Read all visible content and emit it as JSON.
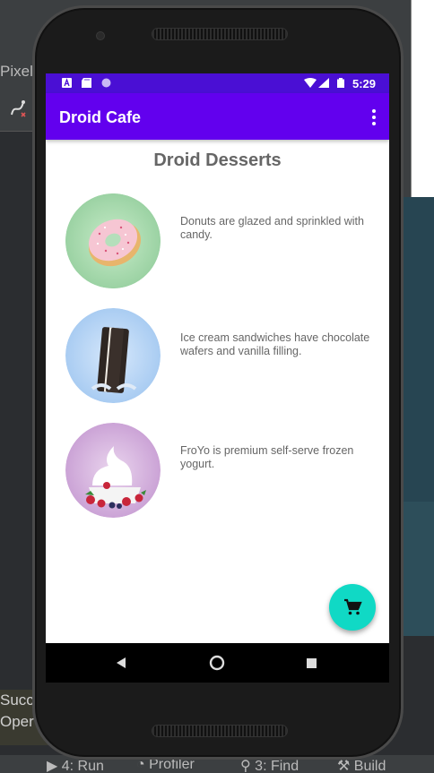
{
  "app": {
    "title": "Droid Cafe",
    "heading": "Droid Desserts",
    "time": "5:29"
  },
  "desserts": [
    {
      "name": "donut",
      "description": "Donuts are glazed and sprinkled with candy."
    },
    {
      "name": "ice-cream-sandwich",
      "description": "Ice cream sandwiches have chocolate wafers and vanilla filling."
    },
    {
      "name": "froyo",
      "description": "FroYo is premium self-serve frozen yogurt."
    }
  ],
  "ide": {
    "device_label": "Pixel",
    "console_lines": [
      "Succ",
      "Oper"
    ],
    "bottom_tabs": [
      "4: Run",
      "Profiler",
      "3: Find",
      "Build"
    ]
  },
  "colors": {
    "status_bar": "#4a0fd4",
    "app_bar": "#6200ee",
    "fab": "#10d9c5",
    "text_secondary": "#666666"
  },
  "icons": {
    "fab": "shopping-cart-icon",
    "overflow": "more-vert-icon",
    "nav": [
      "back-icon",
      "home-icon",
      "recents-icon"
    ]
  }
}
